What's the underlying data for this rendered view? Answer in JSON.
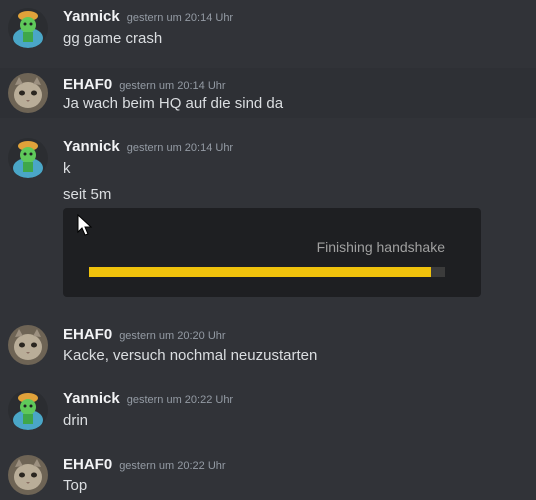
{
  "messages": [
    {
      "user": "Yannick",
      "time": "gestern um 20:14 Uhr",
      "lines": [
        "gg game crash"
      ]
    },
    {
      "user": "EHAF0",
      "time": "gestern um 20:14 Uhr",
      "lines": [
        "Ja wach beim HQ auf die sind da"
      ]
    },
    {
      "user": "Yannick",
      "time": "gestern um 20:14 Uhr",
      "lines": [
        "k",
        "seit 5m"
      ]
    },
    {
      "user": "EHAF0",
      "time": "gestern um 20:20 Uhr",
      "lines": [
        "Kacke, versuch nochmal neuzustarten"
      ]
    },
    {
      "user": "Yannick",
      "time": "gestern um 20:22 Uhr",
      "lines": [
        "drin"
      ]
    },
    {
      "user": "EHAF0",
      "time": "gestern um 20:22 Uhr",
      "lines": [
        "Top"
      ]
    }
  ],
  "embed": {
    "status_text": "Finishing handshake",
    "progress": 0.96,
    "bar_color": "#f0c20c"
  },
  "colors": {
    "background": "#313338",
    "username": "#f2f3f5",
    "timestamp": "#949ba4"
  }
}
